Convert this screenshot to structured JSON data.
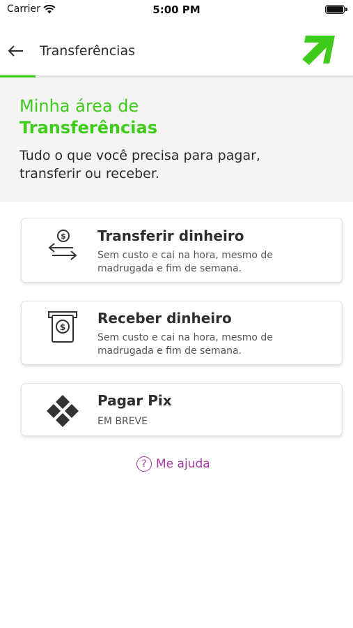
{
  "status_bar": {
    "carrier": "Carrier",
    "time": "5:00 PM"
  },
  "header": {
    "title": "Transferências"
  },
  "hero": {
    "line1": "Minha área de",
    "line2": "Transferências",
    "description": "Tudo o que você precisa para pagar, transferir ou receber."
  },
  "cards": [
    {
      "title": "Transferir dinheiro",
      "description": "Sem custo e cai na hora, mesmo de madrugada e fim de semana.",
      "icon": "transfer-icon"
    },
    {
      "title": "Receber dinheiro",
      "description": "Sem custo e cai na hora, mesmo de madrugada e fim de semana.",
      "icon": "atm-icon"
    },
    {
      "title": "Pagar Pix",
      "description": "EM BREVE",
      "icon": "pix-icon"
    }
  ],
  "help": {
    "label": "Me ajuda",
    "icon": "question-icon"
  },
  "colors": {
    "brand_green": "#3ecb1a",
    "help_purple": "#a23aa8"
  }
}
